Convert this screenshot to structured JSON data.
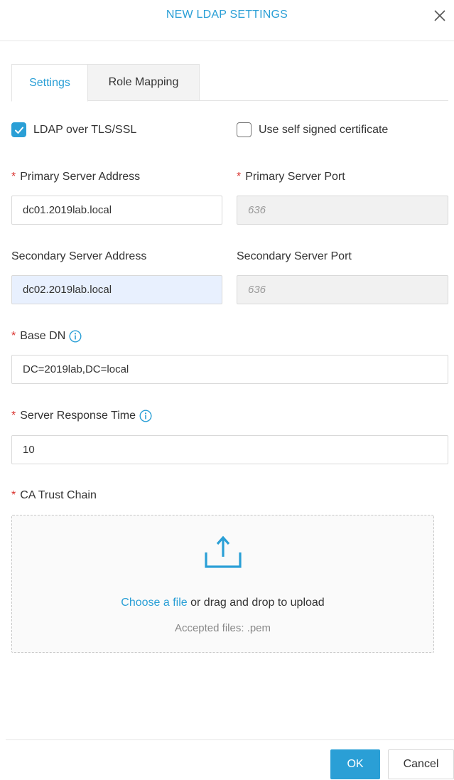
{
  "dialog": {
    "title": "NEW LDAP SETTINGS",
    "close_icon": "close-icon"
  },
  "tabs": [
    {
      "label": "Settings",
      "active": true
    },
    {
      "label": "Role Mapping",
      "active": false
    }
  ],
  "options": {
    "ldap_tls": {
      "label": "LDAP over TLS/SSL",
      "checked": true
    },
    "self_signed": {
      "label": "Use self signed certificate",
      "checked": false
    }
  },
  "fields": {
    "required_marker": "*",
    "primary_address": {
      "label": "Primary Server Address",
      "value": "dc01.2019lab.local",
      "required": true
    },
    "primary_port": {
      "label": "Primary Server Port",
      "value": "636",
      "required": true,
      "disabled": true
    },
    "secondary_address": {
      "label": "Secondary Server Address",
      "value": "dc02.2019lab.local",
      "required": false
    },
    "secondary_port": {
      "label": "Secondary Server Port",
      "value": "636",
      "required": false,
      "disabled": true
    },
    "base_dn": {
      "label": "Base DN",
      "value": "DC=2019lab,DC=local",
      "required": true,
      "info_icon": "info-icon"
    },
    "response_time": {
      "label": "Server Response Time",
      "value": "10",
      "required": true,
      "info_icon": "info-icon"
    },
    "ca_trust_chain": {
      "label": "CA Trust Chain",
      "required": true
    }
  },
  "upload": {
    "icon": "upload-icon",
    "link_text": "Choose a file",
    "text_suffix": " or drag and drop to upload",
    "accepted": "Accepted files: .pem"
  },
  "footer": {
    "ok_label": "OK",
    "cancel_label": "Cancel"
  },
  "colors": {
    "accent": "#2a9fd6",
    "required": "#d9302c",
    "disabled_bg": "#f1f1f1",
    "autofill_bg": "#e8f0fe"
  }
}
